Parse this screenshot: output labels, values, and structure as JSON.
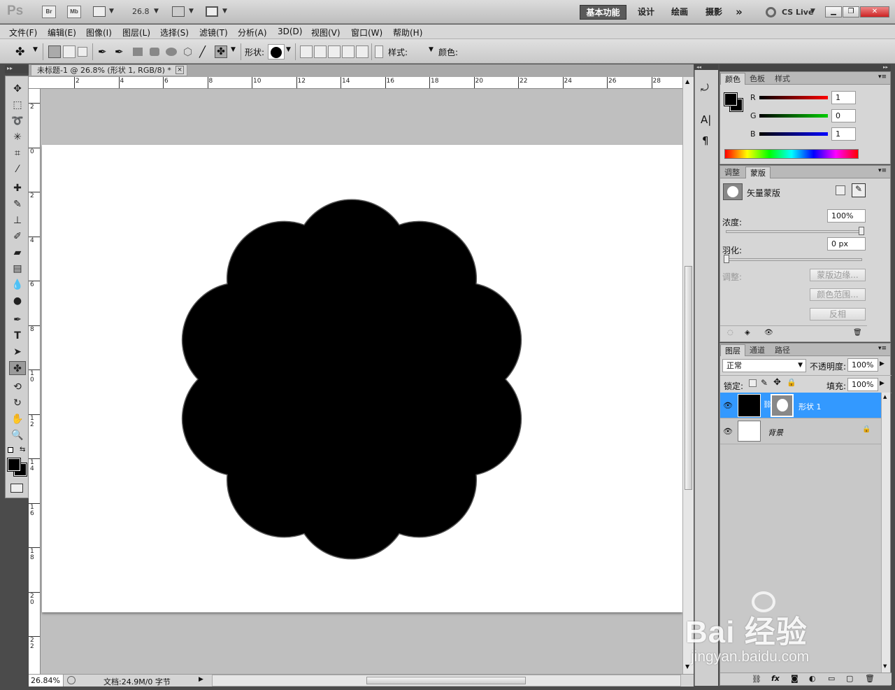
{
  "appbar": {
    "logo": "Ps",
    "bridge": "Br",
    "minibridge": "Mb",
    "zoom": "26.8",
    "workspaces": [
      "基本功能",
      "设计",
      "绘画",
      "摄影"
    ],
    "more": "»",
    "cslive": "CS Live"
  },
  "menubar": [
    "文件(F)",
    "编辑(E)",
    "图像(I)",
    "图层(L)",
    "选择(S)",
    "滤镜(T)",
    "分析(A)",
    "3D(D)",
    "视图(V)",
    "窗口(W)",
    "帮助(H)"
  ],
  "options": {
    "shape_label": "形状:",
    "style_label": "样式:",
    "color_label": "颜色:",
    "color_value": "#000000"
  },
  "document": {
    "tab_title": "未标题-1 @ 26.8% (形状 1, RGB/8) *",
    "close": "×",
    "hruler_ticks": [
      "2",
      "4",
      "6",
      "8",
      "10",
      "12",
      "14",
      "16",
      "18",
      "20",
      "22",
      "24",
      "26",
      "28"
    ],
    "vruler_ticks": [
      "2",
      "0",
      "2",
      "4",
      "6",
      "8",
      "10",
      "12",
      "14",
      "16",
      "18",
      "20",
      "22"
    ],
    "shape_fill": "#000000"
  },
  "status": {
    "zoom": "26.84%",
    "doc_info": "文档:24.9M/0 字节"
  },
  "color_panel": {
    "tabs": [
      "颜色",
      "色板",
      "样式"
    ],
    "channels": [
      {
        "name": "R",
        "value": "1",
        "color": "#cc0000"
      },
      {
        "name": "G",
        "value": "0",
        "color": "#00aa00"
      },
      {
        "name": "B",
        "value": "1",
        "color": "#0000cc"
      }
    ]
  },
  "mask_panel": {
    "tabs": [
      "调整",
      "蒙版"
    ],
    "title": "矢量蒙版",
    "density_label": "浓度:",
    "density_value": "100%",
    "feather_label": "羽化:",
    "feather_value": "0 px",
    "refine_label": "调整:",
    "buttons": [
      "蒙版边缘...",
      "颜色范围...",
      "反相"
    ]
  },
  "layers_panel": {
    "tabs": [
      "图层",
      "通道",
      "路径"
    ],
    "blend_mode": "正常",
    "opacity_label": "不透明度:",
    "opacity_value": "100%",
    "lock_label": "锁定:",
    "fill_label": "填充:",
    "fill_value": "100%",
    "layers": [
      {
        "name": "形状 1",
        "selected": true
      },
      {
        "name": "背景",
        "selected": false,
        "locked": true
      }
    ]
  },
  "watermark": {
    "brand": "Bai 经验",
    "url": "jingyan.baidu.com"
  }
}
